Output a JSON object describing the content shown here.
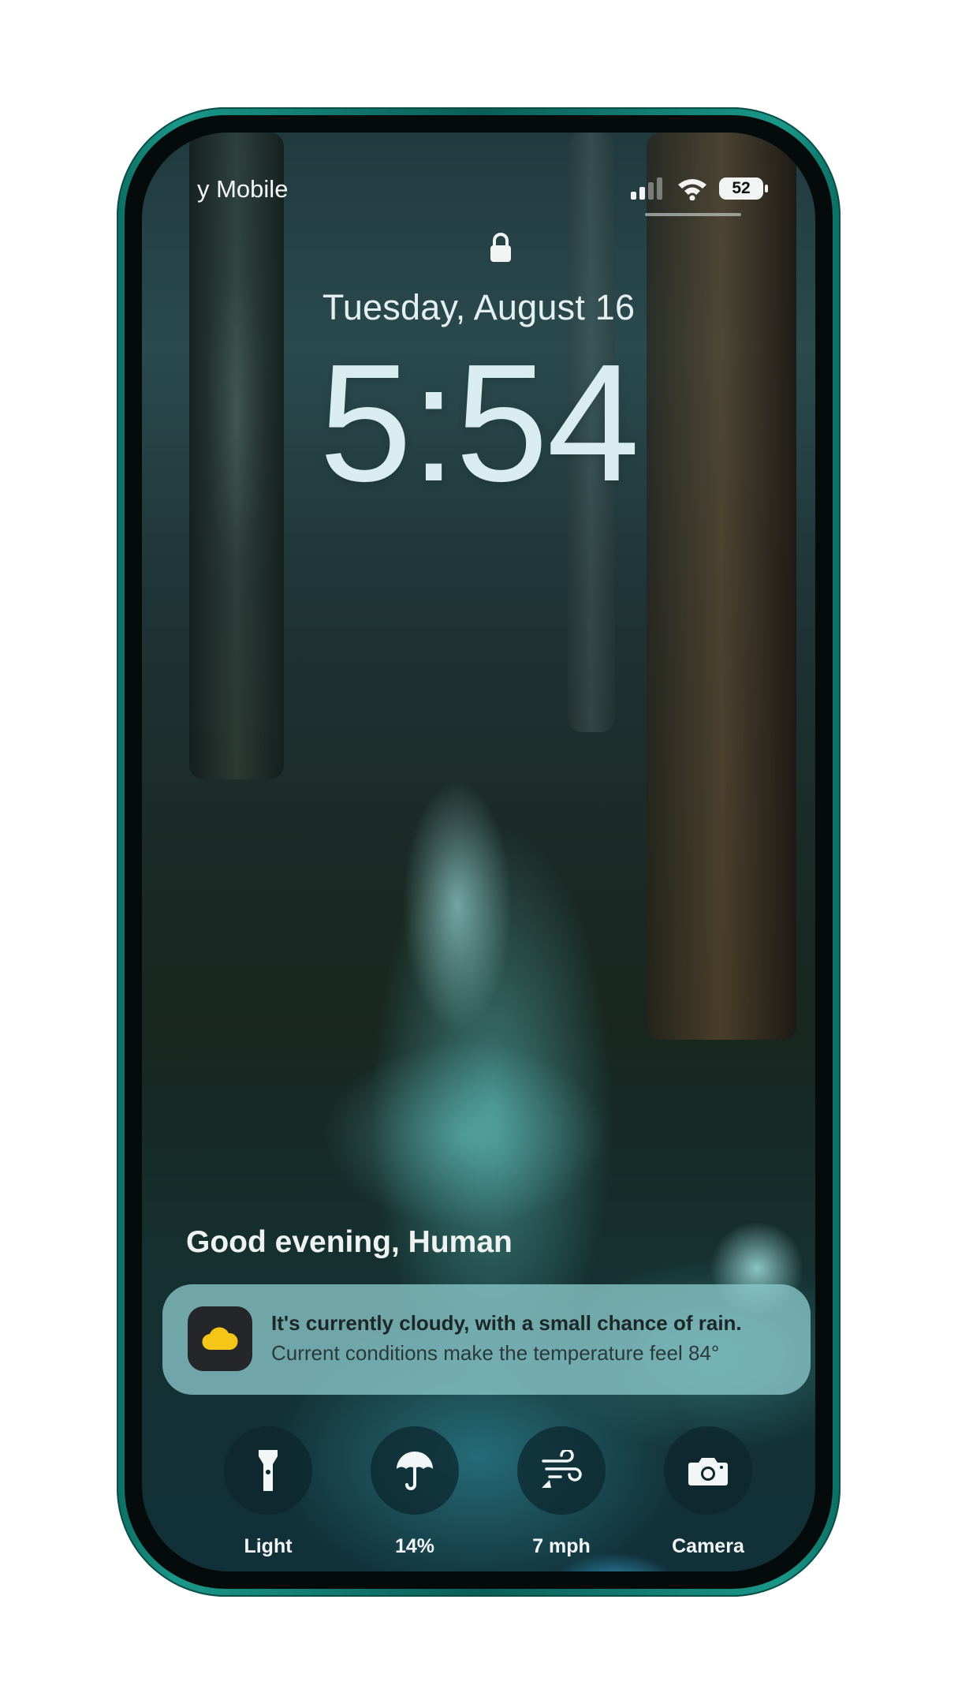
{
  "status_bar": {
    "carrier": "y Mobile",
    "battery_level": "52",
    "signal_bars": 2,
    "wifi_icon": "wifi-icon"
  },
  "lock_screen": {
    "lock_icon": "lock-icon",
    "date": "Tuesday, August 16",
    "time": "5:54",
    "greeting": "Good evening, Human"
  },
  "notification": {
    "icon": "cloud-icon",
    "icon_color": "#f5c518",
    "title": "It's currently cloudy, with a small chance of rain.",
    "body": "Current conditions make the temperature feel 84°"
  },
  "controls": [
    {
      "icon": "flashlight-icon",
      "label": "Light"
    },
    {
      "icon": "umbrella-icon",
      "label": "14%"
    },
    {
      "icon": "wind-icon",
      "label": "7 mph"
    },
    {
      "icon": "camera-icon",
      "label": "Camera"
    }
  ],
  "colors": {
    "frame": "#1a9788",
    "notification_bg": "#8ac8cb",
    "control_bg": "#0c262c"
  }
}
